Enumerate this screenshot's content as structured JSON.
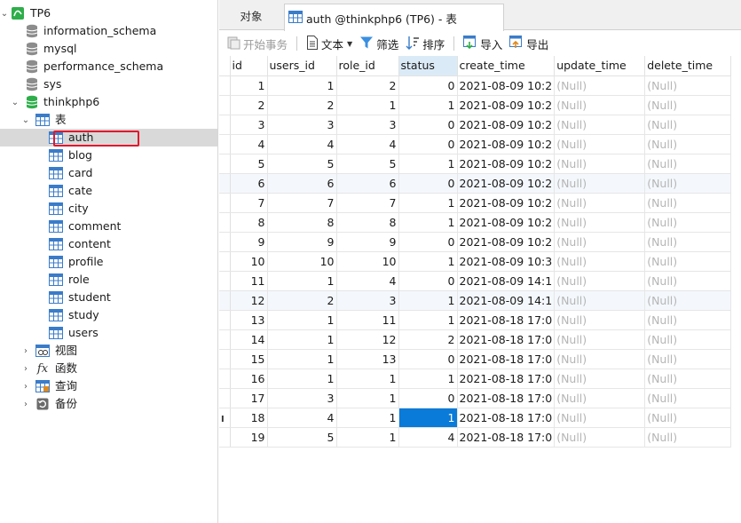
{
  "sidebar": {
    "connection": "TP6",
    "databases": [
      "information_schema",
      "mysql",
      "performance_schema",
      "sys",
      "thinkphp6"
    ],
    "tables_group": "表",
    "tables": [
      "auth",
      "blog",
      "card",
      "cate",
      "city",
      "comment",
      "content",
      "profile",
      "role",
      "student",
      "study",
      "users"
    ],
    "other_groups": [
      "视图",
      "函数",
      "查询",
      "备份"
    ]
  },
  "tabs": {
    "objects_label": "对象",
    "active_label": "auth @thinkphp6 (TP6) - 表"
  },
  "toolbar": {
    "begin_transaction": "开始事务",
    "text": "文本",
    "filter": "筛选",
    "sort": "排序",
    "import": "导入",
    "export": "导出"
  },
  "grid": {
    "columns": [
      "id",
      "users_id",
      "role_id",
      "status",
      "create_time",
      "update_time",
      "delete_time"
    ],
    "sorted_column": "status",
    "rows": [
      [
        "1",
        "1",
        "2",
        "0",
        "2021-08-09 10:2",
        "(Null)",
        "(Null)"
      ],
      [
        "2",
        "2",
        "1",
        "1",
        "2021-08-09 10:2",
        "(Null)",
        "(Null)"
      ],
      [
        "3",
        "3",
        "3",
        "0",
        "2021-08-09 10:2",
        "(Null)",
        "(Null)"
      ],
      [
        "4",
        "4",
        "4",
        "0",
        "2021-08-09 10:2",
        "(Null)",
        "(Null)"
      ],
      [
        "5",
        "5",
        "5",
        "1",
        "2021-08-09 10:2",
        "(Null)",
        "(Null)"
      ],
      [
        "6",
        "6",
        "6",
        "0",
        "2021-08-09 10:2",
        "(Null)",
        "(Null)"
      ],
      [
        "7",
        "7",
        "7",
        "1",
        "2021-08-09 10:2",
        "(Null)",
        "(Null)"
      ],
      [
        "8",
        "8",
        "8",
        "1",
        "2021-08-09 10:2",
        "(Null)",
        "(Null)"
      ],
      [
        "9",
        "9",
        "9",
        "0",
        "2021-08-09 10:2",
        "(Null)",
        "(Null)"
      ],
      [
        "10",
        "10",
        "10",
        "1",
        "2021-08-09 10:3",
        "(Null)",
        "(Null)"
      ],
      [
        "11",
        "1",
        "4",
        "0",
        "2021-08-09 14:1",
        "(Null)",
        "(Null)"
      ],
      [
        "12",
        "2",
        "3",
        "1",
        "2021-08-09 14:1",
        "(Null)",
        "(Null)"
      ],
      [
        "13",
        "1",
        "11",
        "1",
        "2021-08-18 17:0",
        "(Null)",
        "(Null)"
      ],
      [
        "14",
        "1",
        "12",
        "2",
        "2021-08-18 17:0",
        "(Null)",
        "(Null)"
      ],
      [
        "15",
        "1",
        "13",
        "0",
        "2021-08-18 17:0",
        "(Null)",
        "(Null)"
      ],
      [
        "16",
        "1",
        "1",
        "1",
        "2021-08-18 17:0",
        "(Null)",
        "(Null)"
      ],
      [
        "17",
        "3",
        "1",
        "0",
        "2021-08-18 17:0",
        "(Null)",
        "(Null)"
      ],
      [
        "18",
        "4",
        "1",
        "1",
        "2021-08-18 17:0",
        "(Null)",
        "(Null)"
      ],
      [
        "19",
        "5",
        "1",
        "4",
        "2021-08-18 17:0",
        "(Null)",
        "(Null)"
      ]
    ],
    "current_row_marker": "I"
  },
  "colors": {
    "selection": "#0a7bd8",
    "sorted_header": "#dbeaf7",
    "null_text": "#b5b5b5",
    "highlight_box": "#e0182d",
    "db_active": "#2eae4a"
  }
}
